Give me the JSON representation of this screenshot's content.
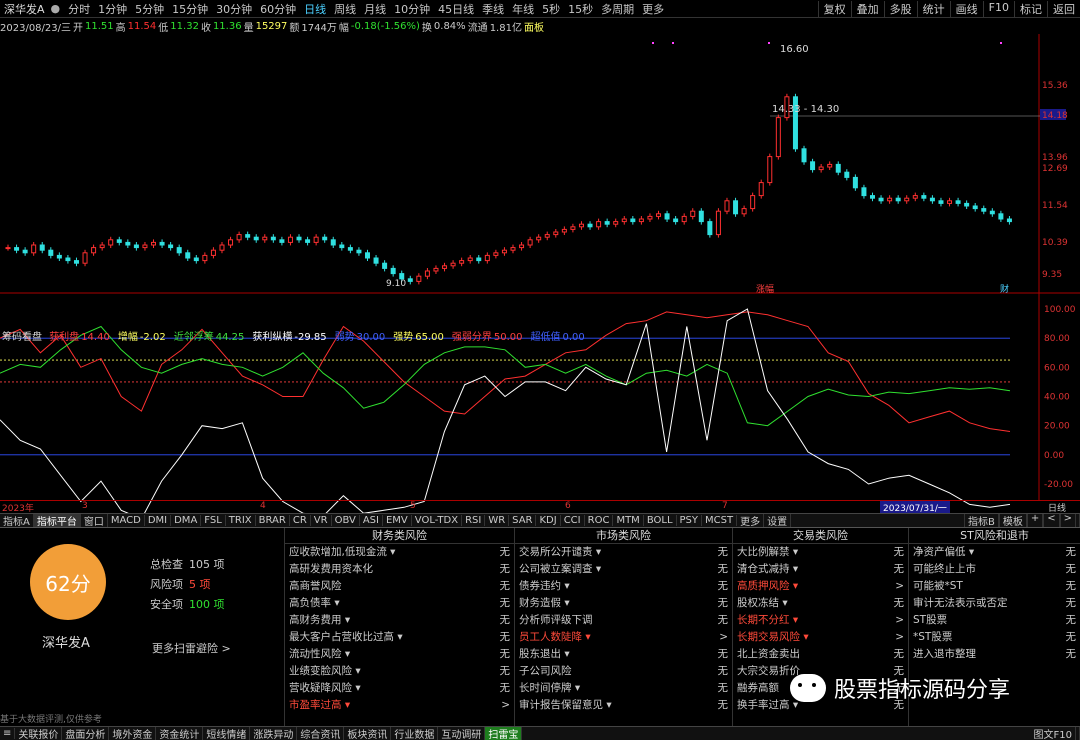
{
  "topbar": {
    "stock_title": "深华发A",
    "periods": [
      "分时",
      "1分钟",
      "5分钟",
      "15分钟",
      "30分钟",
      "60分钟",
      "日线",
      "周线",
      "月线",
      "10分钟",
      "45日线",
      "季线",
      "年线",
      "5秒",
      "15秒",
      "多周期",
      "更多"
    ],
    "active_period": "日线",
    "tools": [
      "复权",
      "叠加",
      "多股",
      "统计",
      "画线",
      "F10",
      "标记",
      "返回"
    ]
  },
  "quote": {
    "date": "2023/08/23/三",
    "open_label": "开",
    "open": "11.51",
    "high_label": "高",
    "high": "11.54",
    "low_label": "低",
    "low": "11.32",
    "close_label": "收",
    "close": "11.36",
    "vol_label": "量",
    "vol": "15297",
    "amount_label": "额",
    "amount": "1744万",
    "change_label": "幅",
    "change": "-0.18(-1.56%)",
    "turnover_label": "换",
    "turnover": "0.84%",
    "float_label": "流通",
    "float_cap": "1.81亿",
    "panel": "面板"
  },
  "price_axis": [
    "15.36",
    "14.18",
    "13.96",
    "12.69",
    "11.54",
    "10.39",
    "9.35"
  ],
  "annotations": {
    "high": "16.60",
    "range": "14.33 - 14.30",
    "low": "9.10",
    "event1": "涨幅",
    "event2": "财"
  },
  "indicator": {
    "name": "筹码看盘",
    "items": [
      {
        "label": "获利盘",
        "value": "14.40",
        "color": "#ff4040"
      },
      {
        "label": "增幅",
        "value": "-2.02",
        "color": "#ffff60"
      },
      {
        "label": "近邻浮筹",
        "value": "44.25",
        "color": "#40e040"
      },
      {
        "label": "获利纵横",
        "value": "-29.85",
        "color": "#ffffff"
      },
      {
        "label": "弱势",
        "value": "30.00",
        "color": "#4060ff"
      },
      {
        "label": "强势",
        "value": "65.00",
        "color": "#ffff60"
      },
      {
        "label": "强弱分界",
        "value": "50.00",
        "color": "#ff4040"
      },
      {
        "label": "超低值",
        "value": "0.00",
        "color": "#4060ff"
      }
    ],
    "axis": [
      "100.00",
      "80.00",
      "60.00",
      "40.00",
      "20.00",
      "0.00",
      "-20.00"
    ]
  },
  "xaxis": [
    "2023年",
    "3",
    "4",
    "5",
    "6",
    "7"
  ],
  "xaxis_date": "2023/07/31/一",
  "xaxis_right": "日线",
  "tabs": [
    "指标A",
    "指标平台",
    "窗口",
    "MACD",
    "DMI",
    "DMA",
    "FSL",
    "TRIX",
    "BRAR",
    "CR",
    "VR",
    "OBV",
    "ASI",
    "EMV",
    "VOL-TDX",
    "RSI",
    "WR",
    "SAR",
    "KDJ",
    "CCI",
    "ROC",
    "MTM",
    "BOLL",
    "PSY",
    "MCST",
    "更多",
    "设置"
  ],
  "tabs_right": [
    "指标B",
    "模板",
    "+",
    "<",
    ">"
  ],
  "risk": {
    "score": "62分",
    "stock_name": "深华发A",
    "total_label": "总检查",
    "total": "105 项",
    "risk_label": "风险项",
    "risk_count": "5 项",
    "safe_label": "安全项",
    "safe_count": "100 项",
    "more": "更多扫雷避险 >",
    "disclaimer": "基于大数据评测,仅供参考",
    "columns": [
      {
        "title": "财务类风险",
        "rows": [
          {
            "label": "应收款增加,低现金流 ▾",
            "status": "无",
            "hl": false
          },
          {
            "label": "高研发费用资本化",
            "status": "无",
            "hl": false
          },
          {
            "label": "高商誉风险",
            "status": "无",
            "hl": false
          },
          {
            "label": "高负债率 ▾",
            "status": "无",
            "hl": false
          },
          {
            "label": "高财务费用 ▾",
            "status": "无",
            "hl": false
          },
          {
            "label": "最大客户占营收比过高 ▾",
            "status": "无",
            "hl": false
          },
          {
            "label": "流动性风险 ▾",
            "status": "无",
            "hl": false
          },
          {
            "label": "业绩变脸风险 ▾",
            "status": "无",
            "hl": false
          },
          {
            "label": "营收疑降风险 ▾",
            "status": "无",
            "hl": false
          },
          {
            "label": "市盈率过高 ▾",
            "status": ">",
            "hl": true
          }
        ]
      },
      {
        "title": "市场类风险",
        "rows": [
          {
            "label": "交易所公开谴责 ▾",
            "status": "无",
            "hl": false
          },
          {
            "label": "公司被立案调查 ▾",
            "status": "无",
            "hl": false
          },
          {
            "label": "债券违约 ▾",
            "status": "无",
            "hl": false
          },
          {
            "label": "财务造假 ▾",
            "status": "无",
            "hl": false
          },
          {
            "label": "分析师评级下调",
            "status": "无",
            "hl": false
          },
          {
            "label": "员工人数陡降 ▾",
            "status": ">",
            "hl": true
          },
          {
            "label": "股东退出 ▾",
            "status": "无",
            "hl": false
          },
          {
            "label": "子公司风险",
            "status": "无",
            "hl": false
          },
          {
            "label": "长时间停牌 ▾",
            "status": "无",
            "hl": false
          },
          {
            "label": "审计报告保留意见 ▾",
            "status": "无",
            "hl": false
          }
        ]
      },
      {
        "title": "交易类风险",
        "rows": [
          {
            "label": "大比例解禁 ▾",
            "status": "无",
            "hl": false
          },
          {
            "label": "清仓式减持 ▾",
            "status": "无",
            "hl": false
          },
          {
            "label": "高质押风险 ▾",
            "status": ">",
            "hl": true
          },
          {
            "label": "股权冻结 ▾",
            "status": "无",
            "hl": false
          },
          {
            "label": "长期不分红 ▾",
            "status": ">",
            "hl": true
          },
          {
            "label": "长期交易风险 ▾",
            "status": ">",
            "hl": true
          },
          {
            "label": "北上资金卖出",
            "status": "无",
            "hl": false
          },
          {
            "label": "大宗交易折价",
            "status": "无",
            "hl": false
          },
          {
            "label": "融券高额",
            "status": "无",
            "hl": false
          },
          {
            "label": "换手率过高 ▾",
            "status": "无",
            "hl": false
          }
        ]
      },
      {
        "title": "ST风险和退市",
        "rows": [
          {
            "label": "净资产偏低 ▾",
            "status": "无",
            "hl": false
          },
          {
            "label": "可能终止上市",
            "status": "无",
            "hl": false
          },
          {
            "label": "可能被*ST",
            "status": "无",
            "hl": false
          },
          {
            "label": "审计无法表示或否定",
            "status": "无",
            "hl": false
          },
          {
            "label": "ST股票",
            "status": "无",
            "hl": false
          },
          {
            "label": "*ST股票",
            "status": "无",
            "hl": false
          },
          {
            "label": "进入退市整理",
            "status": "无",
            "hl": false
          }
        ]
      }
    ]
  },
  "watermark": "股票指标源码分享",
  "bottom_tabs": [
    "关联报价",
    "盘面分析",
    "境外资金",
    "资金统计",
    "短线情绪",
    "涨跌异动",
    "综合资讯",
    "板块资讯",
    "行业数据",
    "互动调研",
    "扫雷宝"
  ],
  "bottom_active": "扫雷宝",
  "bottom_right": "图文F10",
  "colors": {
    "up": "#ff3030",
    "down": "#30e0e0",
    "accent": "#4bd0ff",
    "score": "#f29e38"
  }
}
